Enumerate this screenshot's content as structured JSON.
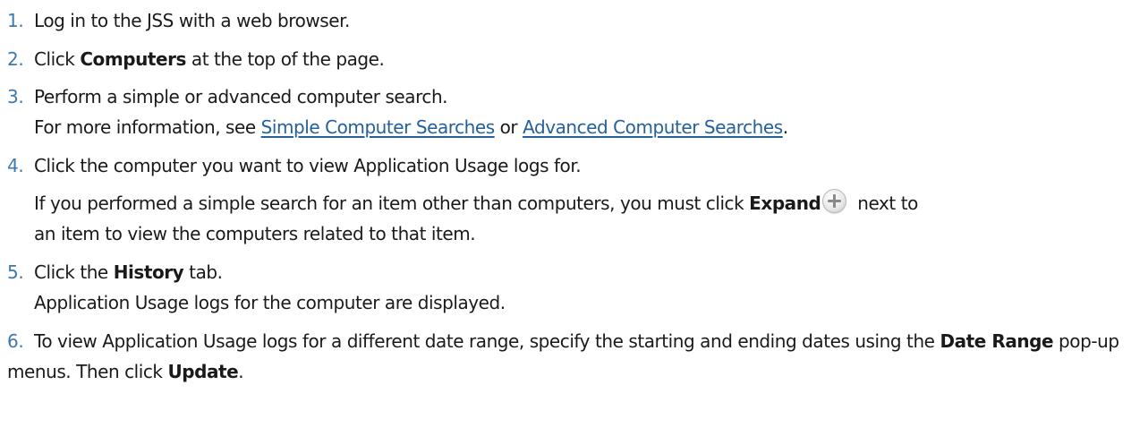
{
  "steps": [
    {
      "num": "1.",
      "text": "Log in to the JSS with a web browser."
    },
    {
      "num": "2.",
      "pre": "Click ",
      "bold": "Computers",
      "post": " at the top of the page."
    },
    {
      "num": "3.",
      "text": "Perform a simple or advanced computer search.",
      "info_pre": "For more information, see ",
      "link1": "Simple Computer Searches",
      "info_mid": " or ",
      "link2": "Advanced Computer Searches",
      "info_post": "."
    },
    {
      "num": "4.",
      "text": "Click the computer you want to view Application Usage logs for.",
      "note_pre": "If you performed a simple search for an item other than computers, you must click ",
      "note_bold": "Expand",
      "note_post": " next to",
      "note_line2": "an item to view the computers related to that item.",
      "icon": "plus-circle-icon"
    },
    {
      "num": "5.",
      "pre": "Click the ",
      "bold": "History",
      "post": " tab.",
      "result": "Application Usage logs for the computer are displayed."
    },
    {
      "num": "6.",
      "line1": "To view Application Usage logs for a different date range, specify the starting and ending dates using",
      "line2_pre": "the ",
      "line2_bold": "Date Range",
      "line2_mid": " pop-up menus. Then click ",
      "line2_bold2": "Update",
      "line2_post": "."
    }
  ],
  "colors": {
    "number": "#3e78b0",
    "link": "#24609a",
    "text": "#1a1a1a"
  }
}
